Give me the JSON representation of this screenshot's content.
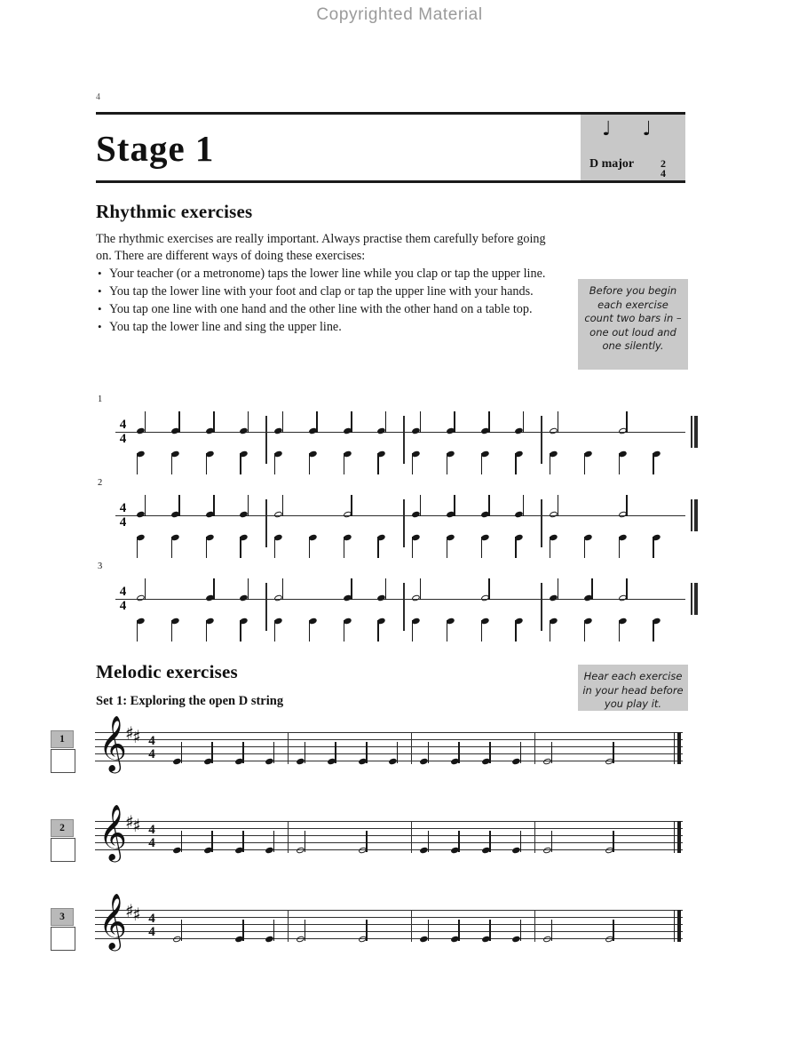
{
  "watermark": "Copyrighted Material",
  "folio": "4",
  "banner": {
    "title": "Stage 1",
    "key_label": "D major",
    "time_top": "2",
    "time_bottom": "4",
    "note_glyphs": "♩  ♩"
  },
  "rhythmic": {
    "heading": "Rhythmic exercises",
    "intro": "The rhythmic exercises are really important. Always practise them carefully before going on. There are different ways of doing these exercises:",
    "bullets": [
      "Your teacher (or a metronome) taps the lower line while you clap or tap the upper line.",
      "You tap the lower line with your foot and clap or tap the upper line with your hands.",
      "You tap one line with one hand and the other line with the other hand on a table top.",
      "You tap the lower line and sing the upper line."
    ],
    "tip": "Before you begin each exercise count two bars in – one out loud and one silently.",
    "time_top": "4",
    "time_bottom": "4",
    "exercises": [
      {
        "number": "1",
        "bars": [
          {
            "upper": [
              "q",
              "q",
              "q",
              "q"
            ],
            "lower": [
              "q",
              "q",
              "q",
              "q"
            ]
          },
          {
            "upper": [
              "q",
              "q",
              "q",
              "q"
            ],
            "lower": [
              "q",
              "q",
              "q",
              "q"
            ]
          },
          {
            "upper": [
              "q",
              "q",
              "q",
              "q"
            ],
            "lower": [
              "q",
              "q",
              "q",
              "q"
            ]
          },
          {
            "upper": [
              "h",
              "h"
            ],
            "lower": [
              "q",
              "q",
              "q",
              "q"
            ]
          }
        ]
      },
      {
        "number": "2",
        "bars": [
          {
            "upper": [
              "q",
              "q",
              "q",
              "q"
            ],
            "lower": [
              "q",
              "q",
              "q",
              "q"
            ]
          },
          {
            "upper": [
              "h",
              "h"
            ],
            "lower": [
              "q",
              "q",
              "q",
              "q"
            ]
          },
          {
            "upper": [
              "q",
              "q",
              "q",
              "q"
            ],
            "lower": [
              "q",
              "q",
              "q",
              "q"
            ]
          },
          {
            "upper": [
              "h",
              "h"
            ],
            "lower": [
              "q",
              "q",
              "q",
              "q"
            ]
          }
        ]
      },
      {
        "number": "3",
        "bars": [
          {
            "upper": [
              "h",
              "q",
              "q"
            ],
            "lower": [
              "q",
              "q",
              "q",
              "q"
            ]
          },
          {
            "upper": [
              "h",
              "q",
              "q"
            ],
            "lower": [
              "q",
              "q",
              "q",
              "q"
            ]
          },
          {
            "upper": [
              "h",
              "h"
            ],
            "lower": [
              "q",
              "q",
              "q",
              "q"
            ]
          },
          {
            "upper": [
              "q",
              "q",
              "h"
            ],
            "lower": [
              "q",
              "q",
              "q",
              "q"
            ]
          }
        ]
      }
    ]
  },
  "melodic": {
    "heading": "Melodic exercises",
    "subhead": "Set 1: Exploring the open D string",
    "tip": "Hear each exercise in your head before you play it.",
    "clef": "treble-clef",
    "key_signature": "2 sharps",
    "time_top": "4",
    "time_bottom": "4",
    "exercises": [
      {
        "number": "1",
        "bars": [
          {
            "notes": [
              "q",
              "q",
              "q",
              "q"
            ]
          },
          {
            "notes": [
              "q",
              "q",
              "q",
              "q"
            ]
          },
          {
            "notes": [
              "q",
              "q",
              "q",
              "q"
            ]
          },
          {
            "notes": [
              "h",
              "h"
            ]
          }
        ]
      },
      {
        "number": "2",
        "bars": [
          {
            "notes": [
              "q",
              "q",
              "q",
              "q"
            ]
          },
          {
            "notes": [
              "h",
              "h"
            ]
          },
          {
            "notes": [
              "q",
              "q",
              "q",
              "q"
            ]
          },
          {
            "notes": [
              "h",
              "h"
            ]
          }
        ]
      },
      {
        "number": "3",
        "bars": [
          {
            "notes": [
              "h",
              "q",
              "q"
            ]
          },
          {
            "notes": [
              "h",
              "h"
            ]
          },
          {
            "notes": [
              "q",
              "q",
              "q",
              "q"
            ]
          },
          {
            "notes": [
              "h",
              "h"
            ]
          }
        ]
      }
    ]
  },
  "colors": {
    "gray_box": "#c8c8c8",
    "ink": "#111111",
    "watermark": "#9a9a9a"
  }
}
